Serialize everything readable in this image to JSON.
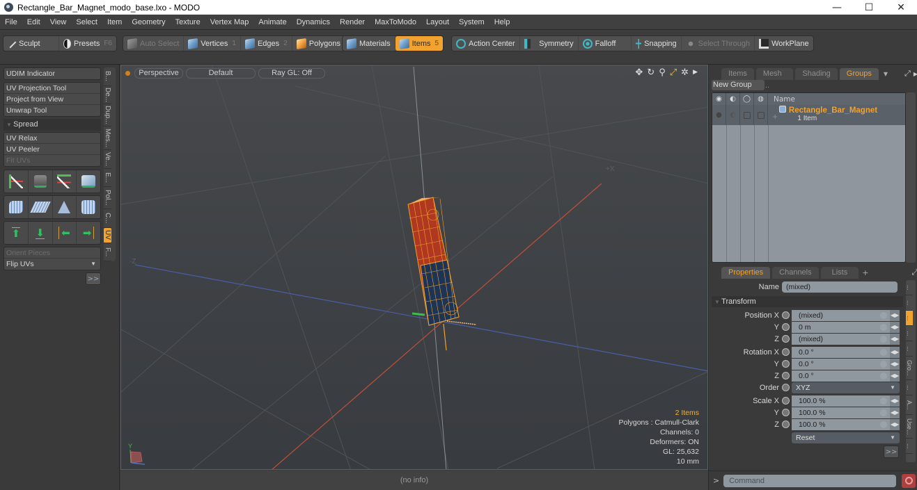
{
  "window": {
    "title": "Rectangle_Bar_Magnet_modo_base.lxo - MODO",
    "controls": {
      "minimize": "—",
      "maximize": "☐",
      "close": "✕"
    }
  },
  "menu": [
    "File",
    "Edit",
    "View",
    "Select",
    "Item",
    "Geometry",
    "Texture",
    "Vertex Map",
    "Animate",
    "Dynamics",
    "Render",
    "MaxToModo",
    "Layout",
    "System",
    "Help"
  ],
  "toolbar": {
    "sculpt": "Sculpt",
    "presets": "Presets",
    "presets_key": "F6",
    "auto_select": "Auto Select",
    "vertices": "Vertices",
    "vertices_key": "1",
    "edges": "Edges",
    "edges_key": "2",
    "polygons": "Polygons",
    "materials": "Materials",
    "items": "Items",
    "items_key": "5",
    "action_center": "Action Center",
    "symmetry": "Symmetry",
    "falloff": "Falloff",
    "snapping": "Snapping",
    "select_through": "Select Through",
    "workplane": "WorkPlane"
  },
  "left_panel": {
    "udim": "UDIM Indicator",
    "group1": [
      "UV Projection Tool",
      "Project from View",
      "Unwrap Tool"
    ],
    "spread": "Spread",
    "group2": [
      "UV Relax",
      "UV Peeler",
      "Fit UVs"
    ],
    "orient": "Orient Pieces",
    "flip": "Flip UVs",
    "more": ">>",
    "vtabs": [
      "B...",
      "De...",
      "Dup...",
      "Mes...",
      "Ve...",
      "E...",
      "Pol...",
      "C...",
      "UV",
      "F..."
    ],
    "active_vtab": "UV"
  },
  "viewport": {
    "view": "Perspective",
    "shading": "Default",
    "raygl": "Ray GL: Off",
    "axis_plus_x": "+X",
    "axis_minus_z": "-Z",
    "axis_y": "Y",
    "info": {
      "items": "2 Items",
      "polygons": "Polygons : Catmull-Clark",
      "channels": "Channels: 0",
      "deformers": "Deformers: ON",
      "gl": "GL: 25,632",
      "grid": "10 mm"
    },
    "status": "(no info)"
  },
  "groups_panel": {
    "tabs": [
      "Items",
      "Mesh ...",
      "Shading",
      "Groups"
    ],
    "active_tab": "Groups",
    "new_group": "New Group",
    "column_name": "Name",
    "group_name": "Rectangle_Bar_Magnet",
    "group_count": "1 Item"
  },
  "properties_panel": {
    "tabs": [
      "Properties",
      "Channels",
      "Lists"
    ],
    "add_tab": "+",
    "active_tab": "Properties",
    "name_label": "Name",
    "name_value": "(mixed)",
    "transform": "Transform",
    "position": [
      {
        "label": "Position X",
        "value": "(mixed)"
      },
      {
        "label": "Y",
        "value": "0 m"
      },
      {
        "label": "Z",
        "value": "(mixed)"
      }
    ],
    "rotation": [
      {
        "label": "Rotation X",
        "value": "0.0 °"
      },
      {
        "label": "Y",
        "value": "0.0 °"
      },
      {
        "label": "Z",
        "value": "0.0 °"
      }
    ],
    "order_label": "Order",
    "order_value": "XYZ",
    "scale": [
      {
        "label": "Scale X",
        "value": "100.0 %"
      },
      {
        "label": "Y",
        "value": "100.0 %"
      },
      {
        "label": "Z",
        "value": "100.0 %"
      }
    ],
    "reset": "Reset",
    "more": ">>",
    "side_tabs": [
      "...",
      "...",
      "...",
      "...",
      "...",
      "Gro...",
      "...",
      "A...",
      "Use...",
      "..."
    ]
  },
  "command": {
    "prompt": ">",
    "placeholder": "Command"
  },
  "colors": {
    "accent": "#f2a22e",
    "x_axis": "#c0503a",
    "z_axis": "#4a5fa8",
    "y_axis": "#3cc040"
  }
}
